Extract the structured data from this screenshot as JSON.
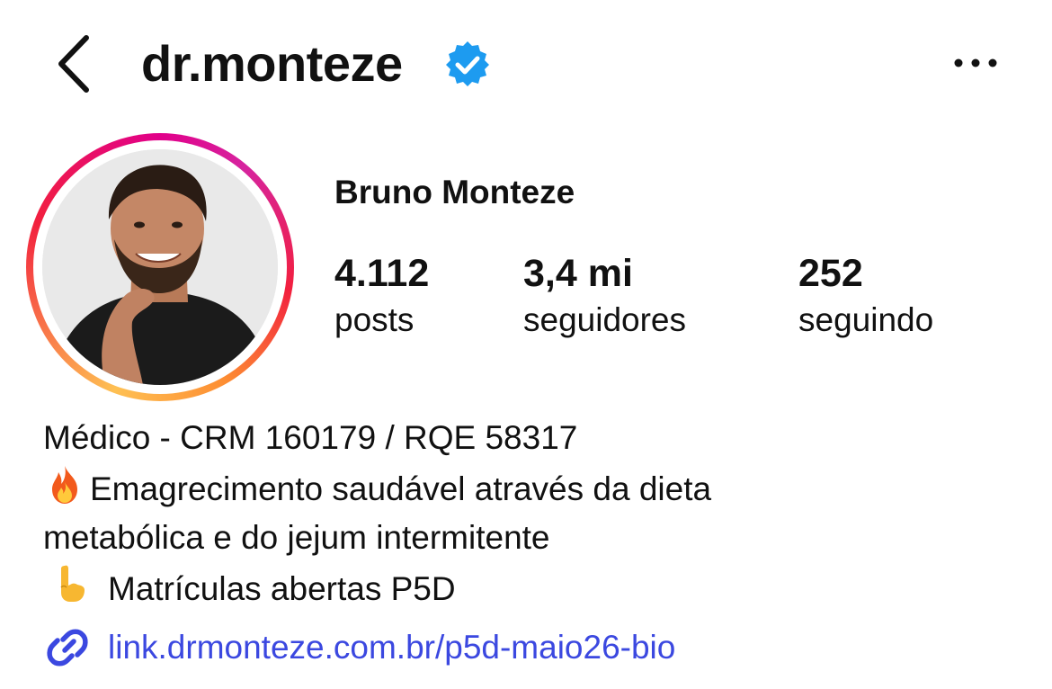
{
  "header": {
    "username": "dr.monteze",
    "back_icon": "chevron-left-icon",
    "verified_icon": "verified-badge-icon",
    "more_icon": "more-horizontal-icon"
  },
  "profile": {
    "full_name": "Bruno Monteze",
    "avatar_ring_colors": [
      "#fec053",
      "#f2203e",
      "#d6249f"
    ]
  },
  "stats": [
    {
      "value": "4.112",
      "label": "posts"
    },
    {
      "value": "3,4 mi",
      "label": "seguidores"
    },
    {
      "value": "252",
      "label": "seguindo"
    }
  ],
  "bio": {
    "line1": "Médico - CRM 160179 / RQE 58317",
    "line2": "Emagrecimento saudável através da dieta",
    "line3": "metabólica e do jejum intermitente",
    "line4": "Matrículas abertas P5D",
    "line2_icon": "fire-emoji-icon",
    "line4_icon": "pointing-down-emoji-icon"
  },
  "link": {
    "text": "link.drmonteze.com.br/p5d-maio26-bio",
    "icon": "link-icon",
    "color": "#3b48e0"
  },
  "colors": {
    "verified": "#1d9bf0",
    "text": "#111111"
  }
}
